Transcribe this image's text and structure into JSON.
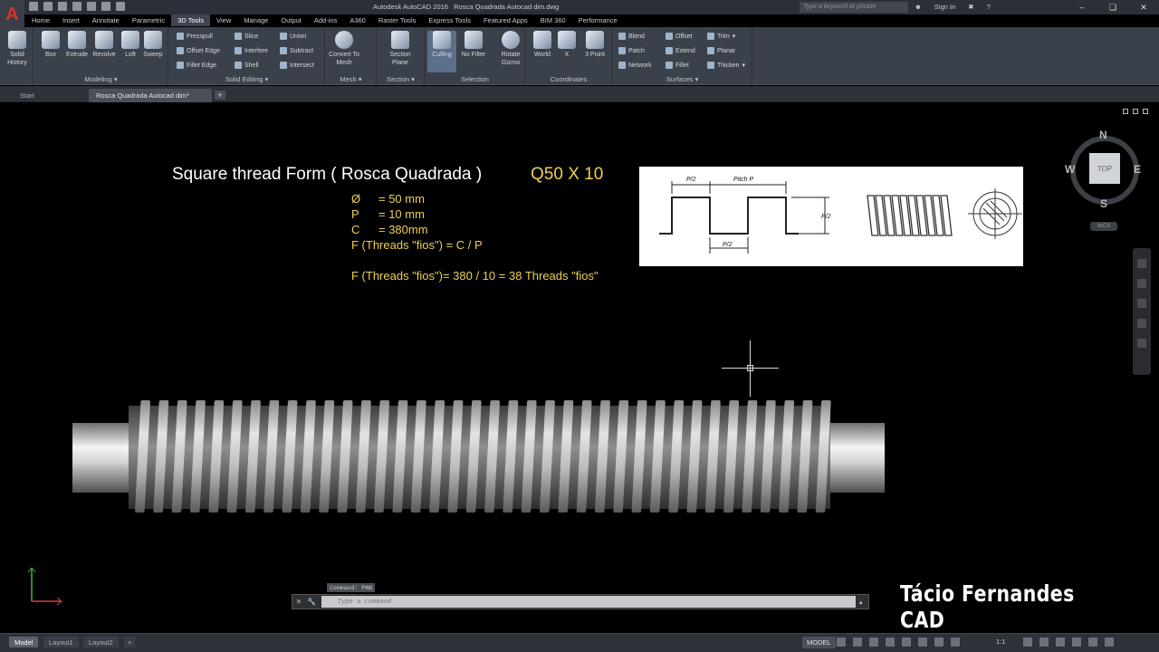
{
  "titlebar": {
    "app_title": "Autodesk AutoCAD 2016",
    "file_title": "Rosca Quadrada Autocad dim.dwg",
    "search_placeholder": "Type a keyword or phrase",
    "signin": "Sign In",
    "logo": "A"
  },
  "menu_tabs": [
    "Home",
    "Insert",
    "Annotate",
    "Parametric",
    "3D Tools",
    "View",
    "Manage",
    "Output",
    "Add-ins",
    "A360",
    "Raster Tools",
    "Express Tools",
    "Featured Apps",
    "BIM 360",
    "Performance"
  ],
  "active_tab": "3D Tools",
  "ribbon": {
    "solid_history": "Solid History",
    "modeling": {
      "label": "Modeling",
      "box": "Box",
      "extrude": "Extrude",
      "revolve": "Revolve",
      "loft": "Loft",
      "sweep": "Sweep"
    },
    "solid_editing": {
      "label": "Solid Editing",
      "presspull": "Presspull",
      "offset_edge": "Offset Edge",
      "fillet_edge": "Fillet Edge",
      "slice": "Slice",
      "interfere": "Interfere",
      "shell": "Shell",
      "union": "Union",
      "subtract": "Subtract",
      "intersect": "Intersect"
    },
    "mesh": {
      "label": "Mesh",
      "convert": "Convert To Mesh"
    },
    "section": {
      "label": "Section",
      "plane": "Section Plane"
    },
    "selection": {
      "label": "Selection",
      "culling": "Culling",
      "no_filter": "No Filter",
      "gizmo": "Rotate Gizmo"
    },
    "coordinates": {
      "label": "Coordinates",
      "world": "World",
      "x": "X",
      "three_point": "3 Point"
    },
    "surfaces": {
      "label": "Surfaces",
      "blend": "Blend",
      "patch": "Patch",
      "network": "Network",
      "offset": "Offset",
      "extend": "Extend",
      "fillet": "Fillet",
      "trim": "Trim",
      "planar": "Planar",
      "thicken": "Thicken"
    }
  },
  "doc_tabs": {
    "start": "Start",
    "active": "Rosca Quadrada Autocad dim*"
  },
  "drawing": {
    "heading": "Square thread Form ( Rosca Quadrada )",
    "heading_spec": "Q50 X 10",
    "line1_sym": "Ø",
    "line1_val": "=   50 mm",
    "line2_sym": "P",
    "line2_val": "=   10 mm",
    "line3_sym": "C",
    "line3_val": "=    380mm",
    "line4": "F (Threads \"fios\") =    C / P",
    "line5": "F  (Threads \"fios\")= 380 / 10 = 38 Threads \"fios\"",
    "ref_half_pitch": "P/2",
    "ref_pitch": "Pitch P",
    "ref_depth": "P/2",
    "ref_bottom": "P/2"
  },
  "viewcube": {
    "n": "N",
    "s": "S",
    "e": "E",
    "w": "W",
    "top": "TOP",
    "wcs": "WCS"
  },
  "command": {
    "history": "Command: PAN",
    "placeholder": "Type a command"
  },
  "watermark": "Tácio Fernandes CAD",
  "statusbar": {
    "model_tab": "Model",
    "layout1": "Layout1",
    "layout2": "Layout2",
    "model": "MODEL",
    "scale": "1:1"
  },
  "thread": {
    "turns": 38
  }
}
